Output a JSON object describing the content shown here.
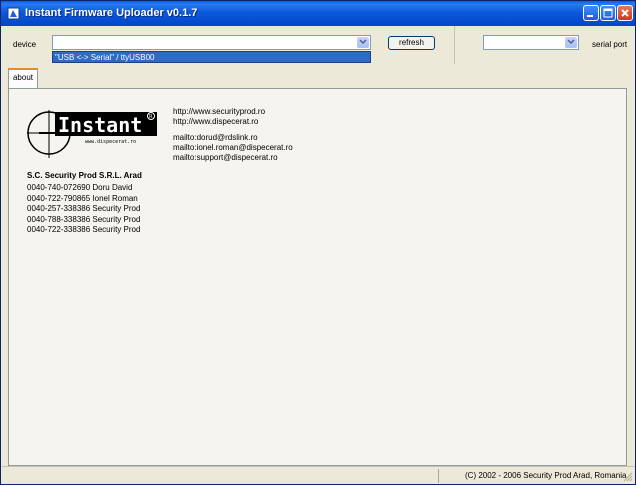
{
  "window": {
    "title": "Instant Firmware Uploader v0.1.7",
    "icon": "app-icon"
  },
  "toolbar": {
    "device_label": "device",
    "device_selected": "",
    "device_dropdown_option": "\"USB <-> Serial\" / ttyUSB00",
    "refresh_label": "refresh",
    "serial_selected": "",
    "serial_label": "serial port"
  },
  "tabs": [
    {
      "label": "about",
      "active": true
    }
  ],
  "about": {
    "logo_text": "Instant",
    "logo_subtext": "www.dispecerat.ro",
    "company": "S.C. Security Prod S.R.L. Arad",
    "phones": [
      "0040-740-072690 Doru David",
      "0040-722-790865 Ionel Roman",
      "0040-257-338386 Security Prod",
      "0040-788-338386 Security Prod",
      "0040-722-338386 Security Prod"
    ],
    "links": [
      "http://www.securityprod.ro",
      "http://www.dispecerat.ro"
    ],
    "mails": [
      "mailto:dorud@rdslink.ro",
      "mailto:ionel.roman@dispecerat.ro",
      "mailto:support@dispecerat.ro"
    ]
  },
  "statusbar": {
    "text": "(C) 2002 - 2006 Security Prod Arad, Romania"
  },
  "colors": {
    "titlebar": "#0d58db",
    "selection": "#316ac5",
    "tab_accent": "#e68b2c"
  }
}
